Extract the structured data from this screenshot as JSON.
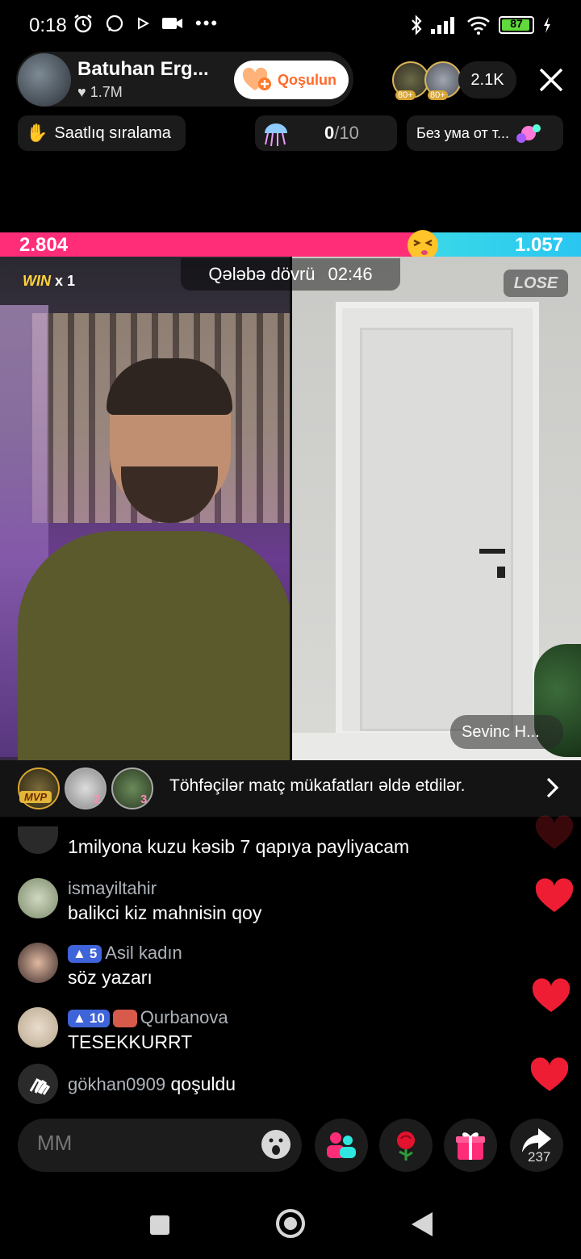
{
  "status_bar": {
    "time": "0:18",
    "battery": "87"
  },
  "host": {
    "name": "Batuhan Erg...",
    "likes": "1.7M",
    "join_label": "Qoşulun"
  },
  "viewers": {
    "badges": [
      "80+",
      "80+"
    ],
    "count": "2.1K"
  },
  "ranking": {
    "label": "Saatlıq sıralama"
  },
  "goal": {
    "current": "0",
    "total": "/10"
  },
  "song": {
    "label": "Без ума от т..."
  },
  "battle": {
    "score_left": "2.804",
    "score_right": "1.057",
    "round_label": "Qələbə dövrü",
    "timer": "02:46",
    "win_label": "WIN",
    "win_count": "x 1",
    "lose_label": "LOSE",
    "guest_name": "Sevinc H..."
  },
  "gifters": {
    "mvp_label": "MVP",
    "ranks": [
      "2",
      "3"
    ],
    "text": "Töhfəçilər matç mükafatları əldə etdilər."
  },
  "chat": [
    {
      "user": "",
      "message": "1milyona kuzu kəsib 7 qapıya payliyacam"
    },
    {
      "user": "ismayiltahir",
      "message": "balikci kiz mahnisin qoy"
    },
    {
      "user": "Asil kadın",
      "level": "5",
      "message": "söz yazarı"
    },
    {
      "user": "Qurbanova",
      "level": "10",
      "message": "TESEKKURRT"
    },
    {
      "user": "gökhan0909",
      "message": "qoşuldu"
    }
  ],
  "composer": {
    "placeholder": "MM",
    "share_count": "237"
  },
  "colors": {
    "accent_pink": "#ff2d78",
    "accent_cyan": "#29c6f2",
    "join_orange": "#ff6a2b"
  }
}
